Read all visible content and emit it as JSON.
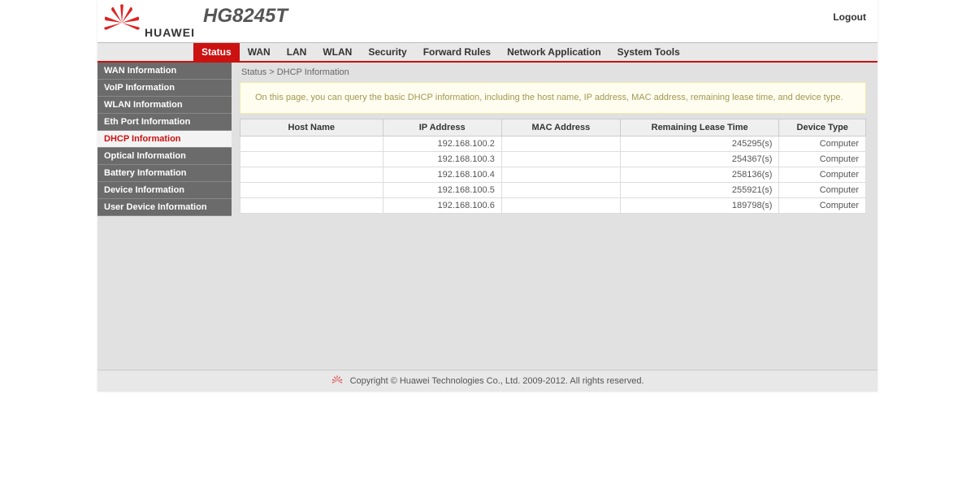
{
  "header": {
    "brand": "HUAWEI",
    "model": "HG8245T",
    "logout": "Logout"
  },
  "topnav": {
    "items": [
      "Status",
      "WAN",
      "LAN",
      "WLAN",
      "Security",
      "Forward Rules",
      "Network Application",
      "System Tools"
    ],
    "active_index": 0
  },
  "sidebar": {
    "items": [
      "WAN Information",
      "VoIP Information",
      "WLAN Information",
      "Eth Port Information",
      "DHCP Information",
      "Optical Information",
      "Battery Information",
      "Device Information",
      "User Device Information"
    ],
    "selected_index": 4
  },
  "breadcrumb": "Status > DHCP Information",
  "infobox": "On this page, you can query the basic DHCP information, including the host name, IP address, MAC address, remaining lease time, and device type.",
  "table": {
    "columns": [
      "Host Name",
      "IP Address",
      "MAC Address",
      "Remaining Lease Time",
      "Device Type"
    ],
    "rows": [
      {
        "host": "",
        "ip": "192.168.100.2",
        "mac": "",
        "lease": "245295(s)",
        "type": "Computer"
      },
      {
        "host": "",
        "ip": "192.168.100.3",
        "mac": "",
        "lease": "254367(s)",
        "type": "Computer"
      },
      {
        "host": "",
        "ip": "192.168.100.4",
        "mac": "",
        "lease": "258136(s)",
        "type": "Computer"
      },
      {
        "host": "",
        "ip": "192.168.100.5",
        "mac": "",
        "lease": "255921(s)",
        "type": "Computer"
      },
      {
        "host": "",
        "ip": "192.168.100.6",
        "mac": "",
        "lease": "189798(s)",
        "type": "Computer"
      }
    ]
  },
  "footer": "Copyright © Huawei Technologies Co., Ltd. 2009-2012. All rights reserved."
}
